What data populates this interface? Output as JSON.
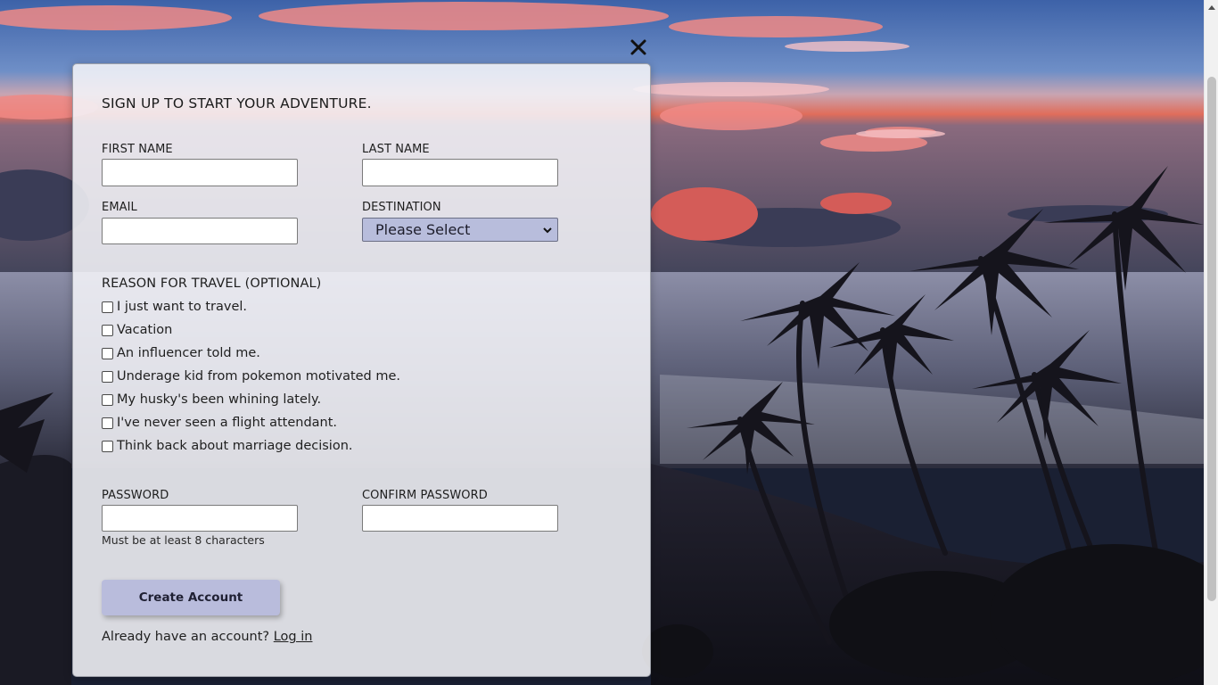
{
  "form": {
    "title": "SIGN UP TO START YOUR ADVENTURE.",
    "first_name_label": "FIRST NAME",
    "last_name_label": "LAST NAME",
    "email_label": "EMAIL",
    "destination_label": "DESTINATION",
    "destination_selected": "Please Select",
    "reason_label": "REASON FOR TRAVEL (OPTIONAL)",
    "reasons": [
      "I just want to travel.",
      "Vacation",
      "An influencer told me.",
      "Underage kid from pokemon motivated me.",
      "My husky's been whining lately.",
      "I've never seen a flight attendant.",
      "Think back about marriage decision."
    ],
    "password_label": "PASSWORD",
    "confirm_password_label": "CONFIRM PASSWORD",
    "password_hint": "Must be at least 8 characters",
    "submit_label": "Create Account",
    "login_prompt": "Already have an account?",
    "login_link": "Log in"
  },
  "icons": {
    "close": "close-icon",
    "select_arrow": "chevron-down-icon"
  },
  "colors": {
    "button": "#b9bcdc",
    "select": "#b8bddc",
    "modal": "#f4f4f8"
  }
}
